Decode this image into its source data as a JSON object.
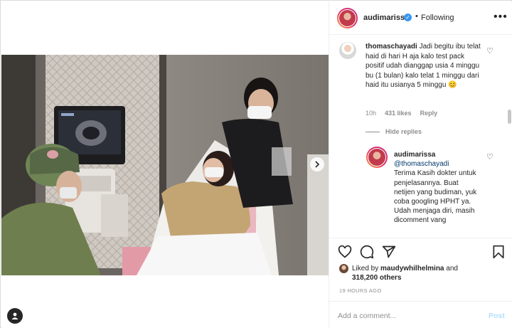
{
  "post": {
    "username": "audimarissa",
    "separator": "•",
    "follow_status": "Following",
    "more_icon": "more-options-icon"
  },
  "comments": [
    {
      "username": "thomaschayadi",
      "text": "Jadi begitu ibu telat haid di hari H aja kalo test pack positif udah dianggap usia 4 minggu bu (1 bulan) kalo telat 1 minggu dari haid itu usianya 5 minggu 😊",
      "time": "10h",
      "likes": "431 likes",
      "reply": "Reply",
      "hide_replies": "Hide replies"
    },
    {
      "username": "audimarissa",
      "mention": "@thomaschayadi",
      "text": "Terima Kasih dokter untuk penjelasannya. Buat netijen yang budiman, yuk coba googling HPHT ya. Udah menjaga diri, masih dicomment vang"
    }
  ],
  "actions": {
    "liked_prefix": "Liked by",
    "liked_user": "maudywhilhelmina",
    "liked_and": "and",
    "liked_others": "318,200 others",
    "timestamp": "19 HOURS AGO"
  },
  "composer": {
    "placeholder": "Add a comment...",
    "post_label": "Post"
  },
  "colors": {
    "link_blue": "#00376b",
    "post_blue": "#b2dffc",
    "verified_blue": "#3897f0",
    "muted_gray": "#8e8e8e"
  }
}
